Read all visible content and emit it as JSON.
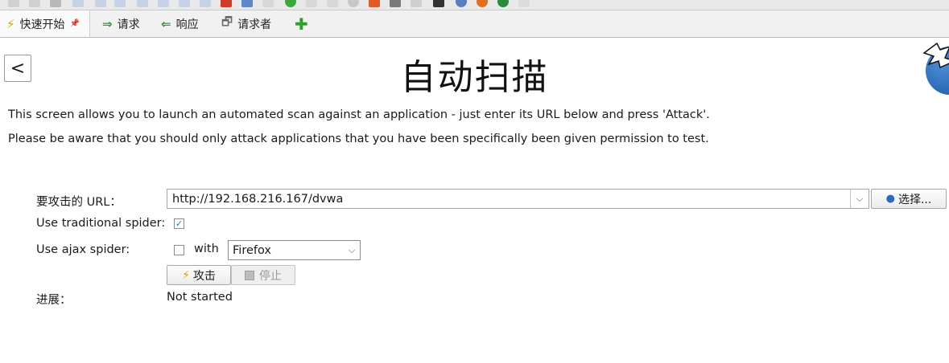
{
  "tabs": [
    {
      "label": "快速开始",
      "icon": "lightning-icon",
      "active": true,
      "pinned": true
    },
    {
      "label": "请求",
      "icon": "arrow-right-icon"
    },
    {
      "label": "响应",
      "icon": "arrow-left-icon"
    },
    {
      "label": "请求者",
      "icon": "requester-icon"
    }
  ],
  "add_tab_symbol": "✚",
  "page": {
    "title": "自动扫描",
    "back_label": "<",
    "description_line1": "This screen allows you to launch an automated scan against  an application - just enter its URL below and press 'Attack'.",
    "description_line2": "Please be aware that you should only attack applications that you have been specifically been given permission to test."
  },
  "form": {
    "url_label": "要攻击的 URL：",
    "url_value": "http://192.168.216.167/dvwa",
    "select_button": "选择...",
    "traditional_spider_label": "Use traditional spider:",
    "traditional_spider_checked": true,
    "ajax_spider_label": "Use ajax spider:",
    "ajax_spider_checked": false,
    "with_label": "with",
    "browser_value": "Firefox",
    "attack_button": "攻击",
    "stop_button": "停止",
    "progress_label": "进展：",
    "progress_value": "Not started"
  },
  "colors": {
    "accent": "#2c6fb6",
    "toolbar_bg": "#e9e9e9",
    "tab_add": "#2e9e2e"
  }
}
